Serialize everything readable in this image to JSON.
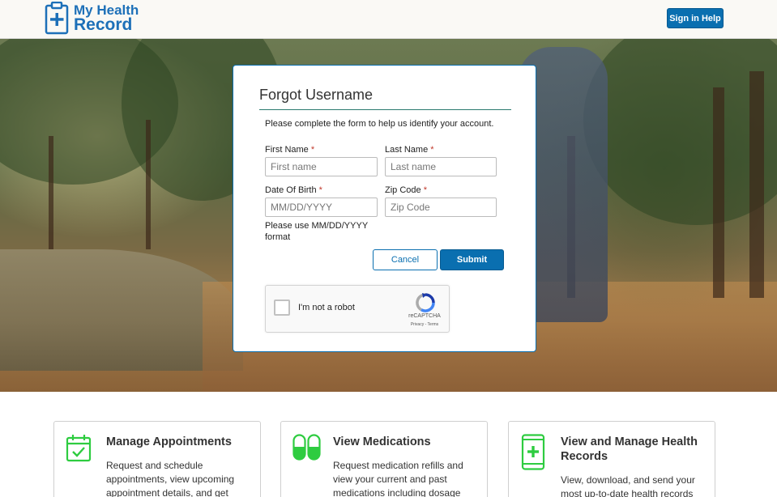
{
  "header": {
    "logo_line1": "My Health",
    "logo_line2": "Record",
    "signin_help_label": "Sign in Help"
  },
  "form": {
    "title": "Forgot Username",
    "description": "Please complete the form to help us identify your account.",
    "required_marker": "*",
    "first_name": {
      "label": "First Name",
      "placeholder": "First name",
      "value": ""
    },
    "last_name": {
      "label": "Last Name",
      "placeholder": "Last name",
      "value": ""
    },
    "dob": {
      "label": "Date Of Birth",
      "placeholder": "MM/DD/YYYY",
      "value": ""
    },
    "zip": {
      "label": "Zip Code",
      "placeholder": "Zip Code",
      "value": ""
    },
    "dob_hint": "Please use MM/DD/YYYY format",
    "cancel_label": "Cancel",
    "submit_label": "Submit",
    "captcha": {
      "label": "I'm not a robot",
      "brand": "reCAPTCHA",
      "links": "Privacy - Terms"
    }
  },
  "features": [
    {
      "icon": "calendar-check-icon",
      "title": "Manage Appointments",
      "desc": "Request and schedule appointments, view upcoming appointment details, and get"
    },
    {
      "icon": "pill-capsule-icon",
      "title": "View Medications",
      "desc": "Request medication refills and view your current and past medications including dosage"
    },
    {
      "icon": "phone-plus-icon",
      "title": "View and Manage Health Records",
      "desc": "View, download, and send your most up-to-date health records"
    }
  ],
  "colors": {
    "primary": "#0a6fb0",
    "accent_green": "#2ecc40",
    "required_red": "#c0392b",
    "title_rule": "#2a7a6e"
  }
}
